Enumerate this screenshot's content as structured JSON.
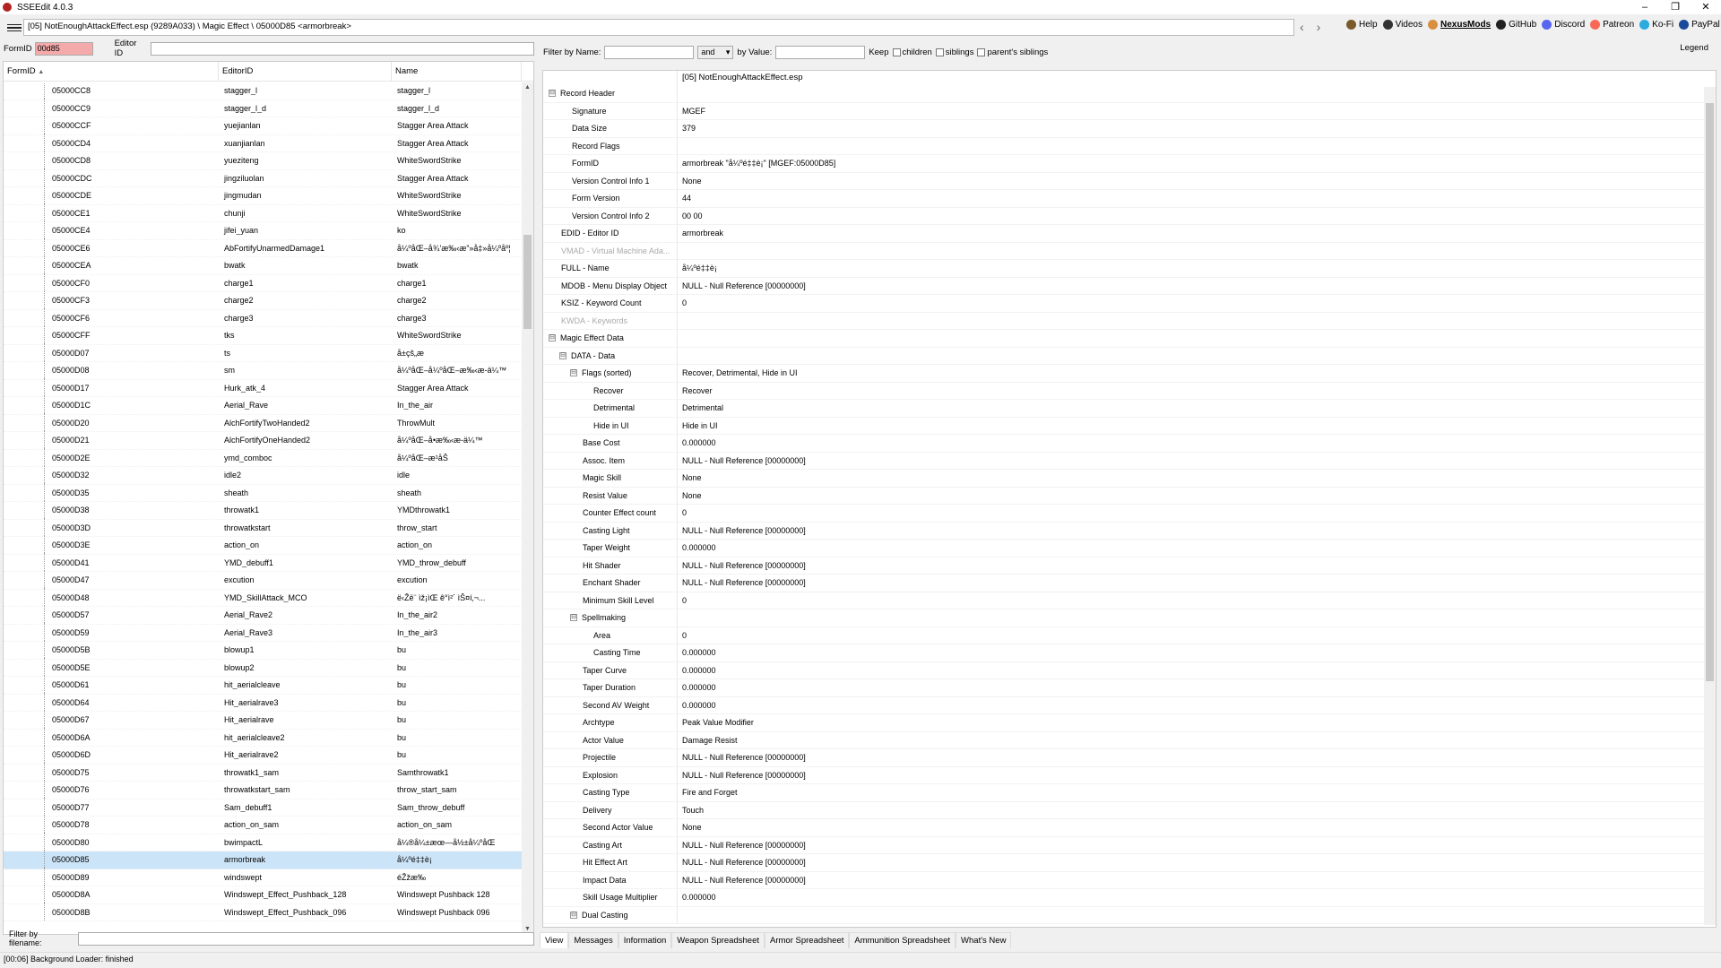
{
  "window": {
    "title": "SSEEdit 4.0.3",
    "minimize": "–",
    "maximize": "❐",
    "close": "✕"
  },
  "toolbar": {
    "path": "[05] NotEnoughAttackEffect.esp (9289A033) \\ Magic Effect \\ 05000D85 <armorbreak>",
    "back": "‹",
    "forward": "›",
    "links": [
      {
        "name": "help-link",
        "label": "Help",
        "color": "#7a5a2a"
      },
      {
        "name": "videos-link",
        "label": "Videos",
        "color": "#333333"
      },
      {
        "name": "nexusmods-link",
        "label": "NexusMods",
        "color": "#d98f40"
      },
      {
        "name": "github-link",
        "label": "GitHub",
        "color": "#222222"
      },
      {
        "name": "discord-link",
        "label": "Discord",
        "color": "#5865f2"
      },
      {
        "name": "patreon-link",
        "label": "Patreon",
        "color": "#f96854"
      },
      {
        "name": "kofi-link",
        "label": "Ko-Fi",
        "color": "#29abe0"
      },
      {
        "name": "paypal-link",
        "label": "PayPal",
        "color": "#1a4a9a"
      }
    ]
  },
  "left": {
    "formid_label": "FormID",
    "formid_value": "00d85",
    "editorid_label": "Editor ID",
    "columns": [
      "FormID",
      "EditorID",
      "Name"
    ],
    "sort_indicator": "▲",
    "rows": [
      [
        "05000CC8",
        "stagger_l",
        "stagger_l"
      ],
      [
        "05000CC9",
        "stagger_l_d",
        "stagger_l_d"
      ],
      [
        "05000CCF",
        "yuejianlan",
        "Stagger Area Attack"
      ],
      [
        "05000CD4",
        "xuanjianlan",
        "Stagger Area Attack"
      ],
      [
        "05000CD8",
        "yueziteng",
        "WhiteSwordStrike"
      ],
      [
        "05000CDC",
        "jingziluolan",
        "Stagger Area Attack"
      ],
      [
        "05000CDE",
        "jingmudan",
        "WhiteSwordStrike"
      ],
      [
        "05000CE1",
        "chunji",
        "WhiteSwordStrike"
      ],
      [
        "05000CE4",
        "jifei_yuan",
        "ko"
      ],
      [
        "05000CE6",
        "AbFortifyUnarmedDamage1",
        "å¼ºåŒ–å¾’æ‰‹æ”»å‡»å¼ºåº¦"
      ],
      [
        "05000CEA",
        "bwatk",
        "bwatk"
      ],
      [
        "05000CF0",
        "charge1",
        "charge1"
      ],
      [
        "05000CF3",
        "charge2",
        "charge2"
      ],
      [
        "05000CF6",
        "charge3",
        "charge3"
      ],
      [
        "05000CFF",
        "tks",
        "WhiteSwordStrike"
      ],
      [
        "05000D07",
        "ts",
        "å±çš„æ"
      ],
      [
        "05000D08",
        "sm",
        "å¼ºåŒ–å¼ºåŒ–æ‰‹æ-ä¼™"
      ],
      [
        "05000D17",
        "Hurk_atk_4",
        "Stagger Area Attack"
      ],
      [
        "05000D1C",
        "Aerial_Rave",
        "In_the_air"
      ],
      [
        "05000D20",
        "AlchFortifyTwoHanded2",
        "ThrowMult"
      ],
      [
        "05000D21",
        "AlchFortifyOneHanded2",
        "å¼ºåŒ–å•æ‰‹æ-ä¼™"
      ],
      [
        "05000D2E",
        "ymd_comboc",
        "å¼ºåŒ–æ¹åŠ"
      ],
      [
        "05000D32",
        "idle2",
        "idle"
      ],
      [
        "05000D35",
        "sheath",
        "sheath"
      ],
      [
        "05000D38",
        "throwatk1",
        "YMDthrowatk1"
      ],
      [
        "05000D3D",
        "throwatkstart",
        "throw_start"
      ],
      [
        "05000D3E",
        "action_on",
        "action_on"
      ],
      [
        "05000D41",
        "YMD_debuff1",
        "YMD_throw_debuff"
      ],
      [
        "05000D47",
        "excution",
        "excution"
      ],
      [
        "05000D48",
        "YMD_SkillAttack_MCO",
        "ë‹Žë¨ ìž¡ìŒ ê°ì²´ ìŠ¤í‚¬..."
      ],
      [
        "05000D57",
        "Aerial_Rave2",
        "In_the_air2"
      ],
      [
        "05000D59",
        "Aerial_Rave3",
        "In_the_air3"
      ],
      [
        "05000D5B",
        "blowup1",
        "bu"
      ],
      [
        "05000D5E",
        "blowup2",
        "bu"
      ],
      [
        "05000D61",
        "hit_aerialcleave",
        "bu"
      ],
      [
        "05000D64",
        "Hit_aerialrave3",
        "bu"
      ],
      [
        "05000D67",
        "Hit_aerialrave",
        "bu"
      ],
      [
        "05000D6A",
        "hit_aerialcleave2",
        "bu"
      ],
      [
        "05000D6D",
        "Hit_aerialrave2",
        "bu"
      ],
      [
        "05000D75",
        "throwatk1_sam",
        "Samthrowatk1"
      ],
      [
        "05000D76",
        "throwatkstart_sam",
        "throw_start_sam"
      ],
      [
        "05000D77",
        "Sam_debuff1",
        "Sam_throw_debuff"
      ],
      [
        "05000D78",
        "action_on_sam",
        "action_on_sam"
      ],
      [
        "05000D80",
        "bwimpactL",
        "å¼®å¼±æœ—å½±å¼ºåŒ"
      ],
      [
        "05000D85",
        "armorbreak",
        "å¼ºé‡‡è¡"
      ],
      [
        "05000D89",
        "windswept",
        "éŽžæ‰"
      ],
      [
        "05000D8A",
        "Windswept_Effect_Pushback_128",
        "Windswept Pushback 128"
      ],
      [
        "05000D8B",
        "Windswept_Effect_Pushback_096",
        "Windswept Pushback 096"
      ]
    ],
    "selected_index": 44,
    "scroll_up": "▲",
    "scroll_down": "▼",
    "filter_label": "Filter by filename:"
  },
  "right": {
    "filter_name_label": "Filter by Name:",
    "logic_value": "and",
    "logic_arrow": "▾",
    "filter_value_label": "by Value:",
    "keep_label": "Keep",
    "children_label": "children",
    "siblings_label": "siblings",
    "parents_siblings_label": "parent's siblings",
    "legend_label": "Legend",
    "file_header": "[05] NotEnoughAttackEffect.esp",
    "tree": [
      {
        "k": "Record Header",
        "v": "",
        "d": 0,
        "e": "⊟"
      },
      {
        "k": "Signature",
        "v": "MGEF",
        "d": 1
      },
      {
        "k": "Data Size",
        "v": "379",
        "d": 1
      },
      {
        "k": "Record Flags",
        "v": "",
        "d": 1
      },
      {
        "k": "FormID",
        "v": "armorbreak \"å¼ºé‡‡è¡\" [MGEF:05000D85]",
        "d": 1
      },
      {
        "k": "Version Control Info 1",
        "v": "None",
        "d": 1
      },
      {
        "k": "Form Version",
        "v": "44",
        "d": 1
      },
      {
        "k": "Version Control Info 2",
        "v": "00 00",
        "d": 1
      },
      {
        "k": "EDID - Editor ID",
        "v": "armorbreak",
        "d": 0
      },
      {
        "k": "VMAD - Virtual Machine Ada...",
        "v": "",
        "d": 0,
        "dim": true
      },
      {
        "k": "FULL - Name",
        "v": "å¼ºé‡‡è¡",
        "d": 0
      },
      {
        "k": "MDOB - Menu Display Object",
        "v": "NULL - Null Reference [00000000]",
        "d": 0
      },
      {
        "k": "KSIZ - Keyword Count",
        "v": "0",
        "d": 0
      },
      {
        "k": "KWDA - Keywords",
        "v": "",
        "d": 0,
        "dim": true
      },
      {
        "k": "Magic Effect Data",
        "v": "",
        "d": 0,
        "e": "⊟"
      },
      {
        "k": "DATA - Data",
        "v": "",
        "d": 1,
        "e": "⊟"
      },
      {
        "k": "Flags (sorted)",
        "v": "Recover, Detrimental, Hide in UI",
        "d": 2,
        "e": "⊟"
      },
      {
        "k": "Recover",
        "v": "Recover",
        "d": 3
      },
      {
        "k": "Detrimental",
        "v": "Detrimental",
        "d": 3
      },
      {
        "k": "Hide in UI",
        "v": "Hide in UI",
        "d": 3
      },
      {
        "k": "Base Cost",
        "v": "0.000000",
        "d": 2
      },
      {
        "k": "Assoc. Item",
        "v": "NULL - Null Reference [00000000]",
        "d": 2
      },
      {
        "k": "Magic Skill",
        "v": "None",
        "d": 2
      },
      {
        "k": "Resist Value",
        "v": "None",
        "d": 2
      },
      {
        "k": "Counter Effect count",
        "v": "0",
        "d": 2
      },
      {
        "k": "Casting Light",
        "v": "NULL - Null Reference [00000000]",
        "d": 2
      },
      {
        "k": "Taper Weight",
        "v": "0.000000",
        "d": 2
      },
      {
        "k": "Hit Shader",
        "v": "NULL - Null Reference [00000000]",
        "d": 2
      },
      {
        "k": "Enchant Shader",
        "v": "NULL - Null Reference [00000000]",
        "d": 2
      },
      {
        "k": "Minimum Skill Level",
        "v": "0",
        "d": 2
      },
      {
        "k": "Spellmaking",
        "v": "",
        "d": 2,
        "e": "⊟"
      },
      {
        "k": "Area",
        "v": "0",
        "d": 3
      },
      {
        "k": "Casting Time",
        "v": "0.000000",
        "d": 3
      },
      {
        "k": "Taper Curve",
        "v": "0.000000",
        "d": 2
      },
      {
        "k": "Taper Duration",
        "v": "0.000000",
        "d": 2
      },
      {
        "k": "Second AV Weight",
        "v": "0.000000",
        "d": 2
      },
      {
        "k": "Archtype",
        "v": "Peak Value Modifier",
        "d": 2
      },
      {
        "k": "Actor Value",
        "v": "Damage Resist",
        "d": 2
      },
      {
        "k": "Projectile",
        "v": "NULL - Null Reference [00000000]",
        "d": 2
      },
      {
        "k": "Explosion",
        "v": "NULL - Null Reference [00000000]",
        "d": 2
      },
      {
        "k": "Casting Type",
        "v": "Fire and Forget",
        "d": 2
      },
      {
        "k": "Delivery",
        "v": "Touch",
        "d": 2
      },
      {
        "k": "Second Actor Value",
        "v": "None",
        "d": 2
      },
      {
        "k": "Casting Art",
        "v": "NULL - Null Reference [00000000]",
        "d": 2
      },
      {
        "k": "Hit Effect Art",
        "v": "NULL - Null Reference [00000000]",
        "d": 2
      },
      {
        "k": "Impact Data",
        "v": "NULL - Null Reference [00000000]",
        "d": 2
      },
      {
        "k": "Skill Usage Multiplier",
        "v": "0.000000",
        "d": 2
      },
      {
        "k": "Dual Casting",
        "v": "",
        "d": 2,
        "e": "⊟"
      }
    ],
    "tabs": [
      "View",
      "Messages",
      "Information",
      "Weapon Spreadsheet",
      "Armor Spreadsheet",
      "Ammunition Spreadsheet",
      "What's New"
    ],
    "active_tab": 0
  },
  "status": "[00:06] Background Loader: finished"
}
